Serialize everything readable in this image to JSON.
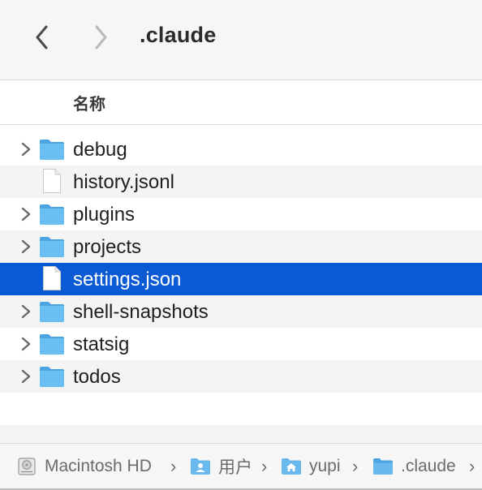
{
  "toolbar": {
    "title": ".claude",
    "back_icon": "chevron-left-icon",
    "forward_icon": "chevron-right-icon"
  },
  "columns": {
    "name_header": "名称"
  },
  "files": [
    {
      "name": "debug",
      "kind": "folder",
      "expandable": true
    },
    {
      "name": "history.jsonl",
      "kind": "file",
      "expandable": false
    },
    {
      "name": "plugins",
      "kind": "folder",
      "expandable": true
    },
    {
      "name": "projects",
      "kind": "folder",
      "expandable": true
    },
    {
      "name": "settings.json",
      "kind": "file",
      "expandable": false,
      "selected": true
    },
    {
      "name": "shell-snapshots",
      "kind": "folder",
      "expandable": true
    },
    {
      "name": "statsig",
      "kind": "folder",
      "expandable": true
    },
    {
      "name": "todos",
      "kind": "folder",
      "expandable": true
    }
  ],
  "pathbar": {
    "crumbs": [
      {
        "label": "Macintosh HD",
        "icon": "hard-drive-icon"
      },
      {
        "label": "用户",
        "icon": "users-folder-icon"
      },
      {
        "label": "yupi",
        "icon": "home-folder-icon"
      },
      {
        "label": ".claude",
        "icon": "folder-icon"
      }
    ],
    "separator": "›"
  },
  "colors": {
    "selection": "#0a5ad4",
    "folder": "#5ab4ec",
    "toolbar_bg": "#f6f6f6",
    "alt_row": "#f4f4f4"
  }
}
